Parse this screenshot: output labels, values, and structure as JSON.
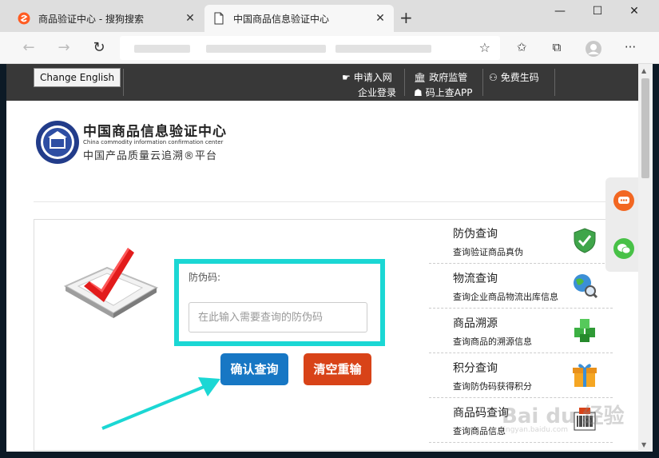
{
  "browser": {
    "tabs": [
      {
        "title": "商品验证中心 - 搜狗搜索",
        "active": false
      },
      {
        "title": "中国商品信息验证中心",
        "active": true
      }
    ],
    "new_tab": "+",
    "window": {
      "minimize": "—",
      "maximize": "☐",
      "close": "✕"
    }
  },
  "topbar": {
    "change_english": "Change English",
    "links": {
      "apply": "申请入网",
      "login": "企业登录",
      "gov": "政府监管",
      "app": "码上查APP",
      "free": "免费生码"
    }
  },
  "logo": {
    "title": "中国商品信息验证中心",
    "english": "China commodity information confirmation center",
    "subtitle": "中国产品质量云追溯®平台"
  },
  "query": {
    "label": "防伪码:",
    "placeholder": "在此输入需要查询的防伪码",
    "confirm_button": "确认查询",
    "clear_button": "清空重输"
  },
  "services": [
    {
      "title": "防伪查询",
      "desc": "查询验证商品真伪",
      "icon": "shield-check-icon"
    },
    {
      "title": "物流查询",
      "desc": "查询企业商品物流出库信息",
      "icon": "globe-search-icon"
    },
    {
      "title": "商品溯源",
      "desc": "查询商品的溯源信息",
      "icon": "green-cubes-icon"
    },
    {
      "title": "积分查询",
      "desc": "查询防伪码获得积分",
      "icon": "gift-icon"
    },
    {
      "title": "商品码查询",
      "desc": "查询商品信息",
      "icon": "barcode-icon"
    }
  ],
  "watermark": {
    "brand": "Bai du 经验",
    "url": "jingyan.baidu.com"
  },
  "colors": {
    "topbar": "#383838",
    "highlight_border": "#1bd7d4",
    "confirm": "#1777c4",
    "clear": "#d84318"
  }
}
